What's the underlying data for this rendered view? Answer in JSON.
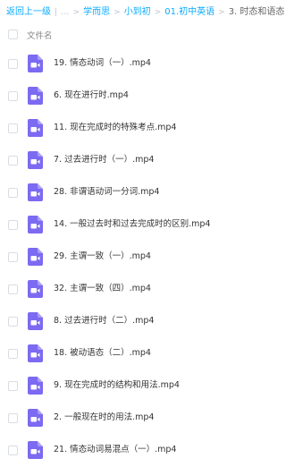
{
  "breadcrumb": {
    "back_label": "返回上一级",
    "ellipsis": "...",
    "items": [
      "学而思",
      "小到初",
      "01.初中英语"
    ],
    "current": "3. 时态和语态"
  },
  "header": {
    "column_label": "文件名"
  },
  "icon_color": "#7c6af2",
  "files": [
    "19. 情态动词（一）.mp4",
    "6. 现在进行时.mp4",
    "11. 现在完成时的特殊考点.mp4",
    "7. 过去进行时（一）.mp4",
    "28. 非谓语动词一分词.mp4",
    "14. 一般过去时和过去完成时的区别.mp4",
    "29. 主谓一致（一）.mp4",
    "32. 主谓一致（四）.mp4",
    "8. 过去进行时（二）.mp4",
    "18. 被动语态（二）.mp4",
    "9. 现在完成时的结构和用法.mp4",
    "2. 一般现在时的用法.mp4",
    "21. 情态动词易混点（一）.mp4"
  ]
}
